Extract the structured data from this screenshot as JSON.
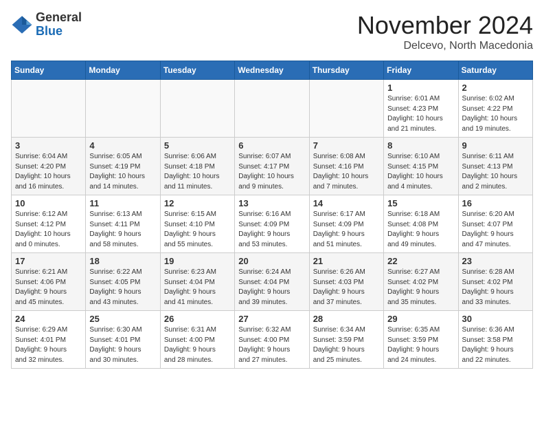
{
  "logo": {
    "general": "General",
    "blue": "Blue"
  },
  "title": "November 2024",
  "subtitle": "Delcevo, North Macedonia",
  "headers": [
    "Sunday",
    "Monday",
    "Tuesday",
    "Wednesday",
    "Thursday",
    "Friday",
    "Saturday"
  ],
  "weeks": [
    [
      {
        "day": "",
        "info": "",
        "empty": true
      },
      {
        "day": "",
        "info": "",
        "empty": true
      },
      {
        "day": "",
        "info": "",
        "empty": true
      },
      {
        "day": "",
        "info": "",
        "empty": true
      },
      {
        "day": "",
        "info": "",
        "empty": true
      },
      {
        "day": "1",
        "info": "Sunrise: 6:01 AM\nSunset: 4:23 PM\nDaylight: 10 hours\nand 21 minutes."
      },
      {
        "day": "2",
        "info": "Sunrise: 6:02 AM\nSunset: 4:22 PM\nDaylight: 10 hours\nand 19 minutes."
      }
    ],
    [
      {
        "day": "3",
        "info": "Sunrise: 6:04 AM\nSunset: 4:20 PM\nDaylight: 10 hours\nand 16 minutes."
      },
      {
        "day": "4",
        "info": "Sunrise: 6:05 AM\nSunset: 4:19 PM\nDaylight: 10 hours\nand 14 minutes."
      },
      {
        "day": "5",
        "info": "Sunrise: 6:06 AM\nSunset: 4:18 PM\nDaylight: 10 hours\nand 11 minutes."
      },
      {
        "day": "6",
        "info": "Sunrise: 6:07 AM\nSunset: 4:17 PM\nDaylight: 10 hours\nand 9 minutes."
      },
      {
        "day": "7",
        "info": "Sunrise: 6:08 AM\nSunset: 4:16 PM\nDaylight: 10 hours\nand 7 minutes."
      },
      {
        "day": "8",
        "info": "Sunrise: 6:10 AM\nSunset: 4:15 PM\nDaylight: 10 hours\nand 4 minutes."
      },
      {
        "day": "9",
        "info": "Sunrise: 6:11 AM\nSunset: 4:13 PM\nDaylight: 10 hours\nand 2 minutes."
      }
    ],
    [
      {
        "day": "10",
        "info": "Sunrise: 6:12 AM\nSunset: 4:12 PM\nDaylight: 10 hours\nand 0 minutes."
      },
      {
        "day": "11",
        "info": "Sunrise: 6:13 AM\nSunset: 4:11 PM\nDaylight: 9 hours\nand 58 minutes."
      },
      {
        "day": "12",
        "info": "Sunrise: 6:15 AM\nSunset: 4:10 PM\nDaylight: 9 hours\nand 55 minutes."
      },
      {
        "day": "13",
        "info": "Sunrise: 6:16 AM\nSunset: 4:09 PM\nDaylight: 9 hours\nand 53 minutes."
      },
      {
        "day": "14",
        "info": "Sunrise: 6:17 AM\nSunset: 4:09 PM\nDaylight: 9 hours\nand 51 minutes."
      },
      {
        "day": "15",
        "info": "Sunrise: 6:18 AM\nSunset: 4:08 PM\nDaylight: 9 hours\nand 49 minutes."
      },
      {
        "day": "16",
        "info": "Sunrise: 6:20 AM\nSunset: 4:07 PM\nDaylight: 9 hours\nand 47 minutes."
      }
    ],
    [
      {
        "day": "17",
        "info": "Sunrise: 6:21 AM\nSunset: 4:06 PM\nDaylight: 9 hours\nand 45 minutes."
      },
      {
        "day": "18",
        "info": "Sunrise: 6:22 AM\nSunset: 4:05 PM\nDaylight: 9 hours\nand 43 minutes."
      },
      {
        "day": "19",
        "info": "Sunrise: 6:23 AM\nSunset: 4:04 PM\nDaylight: 9 hours\nand 41 minutes."
      },
      {
        "day": "20",
        "info": "Sunrise: 6:24 AM\nSunset: 4:04 PM\nDaylight: 9 hours\nand 39 minutes."
      },
      {
        "day": "21",
        "info": "Sunrise: 6:26 AM\nSunset: 4:03 PM\nDaylight: 9 hours\nand 37 minutes."
      },
      {
        "day": "22",
        "info": "Sunrise: 6:27 AM\nSunset: 4:02 PM\nDaylight: 9 hours\nand 35 minutes."
      },
      {
        "day": "23",
        "info": "Sunrise: 6:28 AM\nSunset: 4:02 PM\nDaylight: 9 hours\nand 33 minutes."
      }
    ],
    [
      {
        "day": "24",
        "info": "Sunrise: 6:29 AM\nSunset: 4:01 PM\nDaylight: 9 hours\nand 32 minutes."
      },
      {
        "day": "25",
        "info": "Sunrise: 6:30 AM\nSunset: 4:01 PM\nDaylight: 9 hours\nand 30 minutes."
      },
      {
        "day": "26",
        "info": "Sunrise: 6:31 AM\nSunset: 4:00 PM\nDaylight: 9 hours\nand 28 minutes."
      },
      {
        "day": "27",
        "info": "Sunrise: 6:32 AM\nSunset: 4:00 PM\nDaylight: 9 hours\nand 27 minutes."
      },
      {
        "day": "28",
        "info": "Sunrise: 6:34 AM\nSunset: 3:59 PM\nDaylight: 9 hours\nand 25 minutes."
      },
      {
        "day": "29",
        "info": "Sunrise: 6:35 AM\nSunset: 3:59 PM\nDaylight: 9 hours\nand 24 minutes."
      },
      {
        "day": "30",
        "info": "Sunrise: 6:36 AM\nSunset: 3:58 PM\nDaylight: 9 hours\nand 22 minutes."
      }
    ]
  ]
}
